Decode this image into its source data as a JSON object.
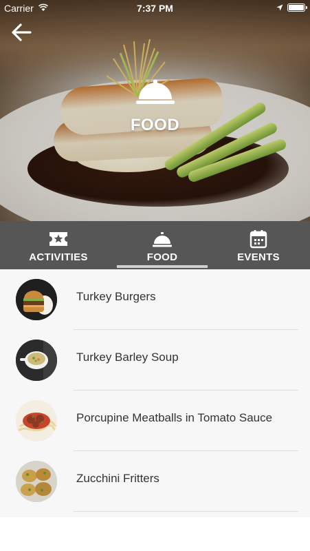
{
  "status_bar": {
    "carrier": "Carrier",
    "time": "7:37 PM"
  },
  "hero": {
    "title": "FOOD",
    "icon": "cloche-icon"
  },
  "tabs": [
    {
      "label": "ACTIVITIES",
      "icon": "ticket-star-icon",
      "active": false
    },
    {
      "label": "FOOD",
      "icon": "cloche-icon",
      "active": true
    },
    {
      "label": "EVENTS",
      "icon": "calendar-icon",
      "active": false
    }
  ],
  "foods": [
    {
      "name": "Turkey Burgers",
      "image": "turkey-burger-image"
    },
    {
      "name": "Turkey Barley Soup",
      "image": "soup-bowl-image"
    },
    {
      "name": "Porcupine Meatballs in Tomato Sauce",
      "image": "meatballs-image"
    },
    {
      "name": "Zucchini Fritters",
      "image": "fritters-image"
    }
  ],
  "colors": {
    "tab_bar": "#565656",
    "list_bg": "#f7f7f7",
    "text": "#333333",
    "indicator": "#cfcfcf"
  }
}
